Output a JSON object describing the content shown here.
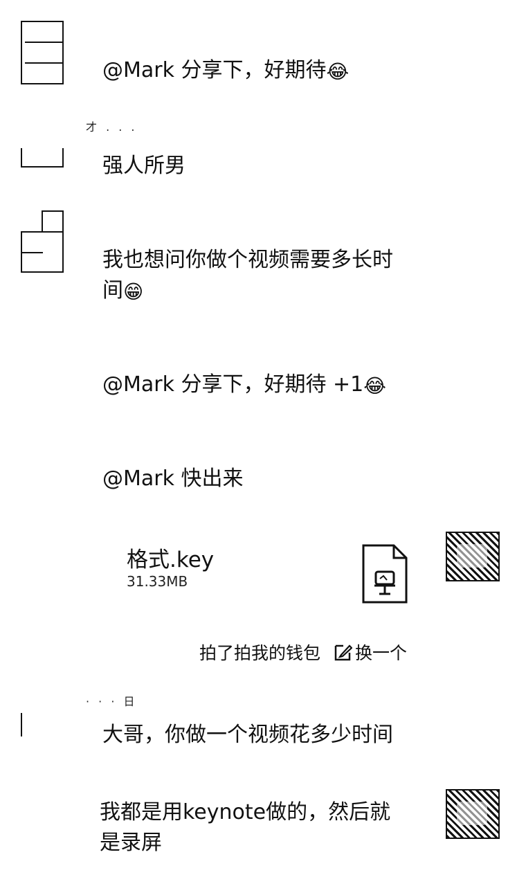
{
  "messages": [
    {
      "text": "@Mark 分享下，好期待",
      "emoji": "😂"
    },
    {
      "text": "强人所男"
    },
    {
      "line1": "我也想问你做个视频需要多长时",
      "line2": "间",
      "emoji": "😁"
    },
    {
      "text": "@Mark 分享下，好期待 +1",
      "emoji": "😂"
    },
    {
      "text": "@Mark 快出来"
    },
    {
      "text": "大哥，你做一个视频花多少时间"
    },
    {
      "line1": "我都是用keynote做的，然后就",
      "line2": "是录屏"
    }
  ],
  "name_fragment_1": "才 . . .",
  "name_fragment_2": "· · · 日",
  "file": {
    "name": "格式.key",
    "size": "31.33MB",
    "icon": "keynote-file-icon"
  },
  "quote_bar": {
    "text": "拍了拍我的钱包",
    "swap_label": "换一个",
    "swap_icon": "edit-swap-icon"
  },
  "colors": {
    "text": "#111111",
    "background": "#ffffff"
  }
}
